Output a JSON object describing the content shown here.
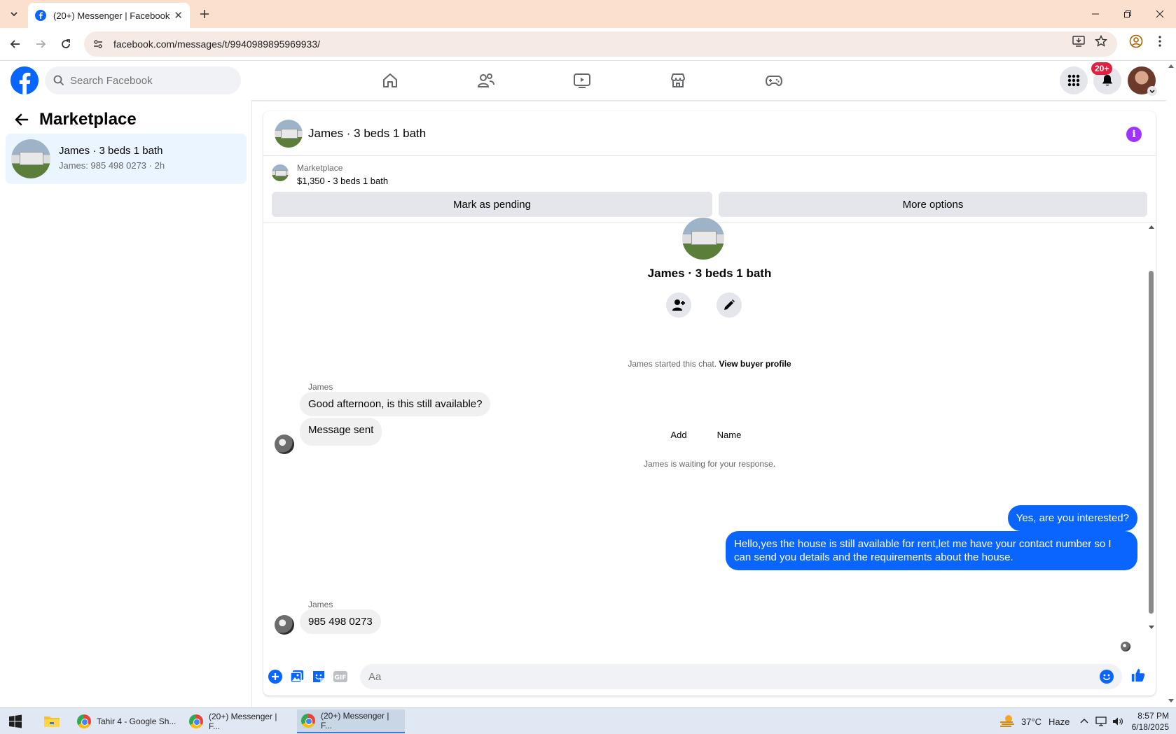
{
  "browser": {
    "tab_title": "(20+) Messenger | Facebook",
    "url": "facebook.com/messages/t/9940989895969933/"
  },
  "fb": {
    "search_placeholder": "Search Facebook",
    "notifications_badge": "20+",
    "brand_color": "#0866ff"
  },
  "sidebar": {
    "title": "Marketplace",
    "conversations": [
      {
        "name": "James · 3 beds 1 bath",
        "preview": "James: 985 498 0273 · 2h"
      }
    ]
  },
  "chat": {
    "header_name": "James · 3 beds 1 bath",
    "listing": {
      "label": "Marketplace",
      "price_title": "$1,350 - 3 beds 1 bath",
      "mark_pending": "Mark as pending",
      "more_options": "More options"
    },
    "profile_name": "James · 3 beds 1 bath",
    "actions": {
      "add": "Add",
      "name": "Name"
    },
    "started_text": "James started this chat.",
    "view_profile": "View buyer profile",
    "waiting_text": "James is waiting for your response.",
    "messages": [
      {
        "sender": "James",
        "text": "Good afternoon, is this still available?"
      },
      {
        "text": "Message sent"
      },
      {
        "text": "Yes, are you interested?"
      },
      {
        "text": "Hello,yes the house is still available for rent,let me have your contact number   so I can send you details and the requirements about the house."
      },
      {
        "sender": "James",
        "text": "985 498 0273"
      }
    ],
    "composer_placeholder": "Aa",
    "outgoing_color": "#0a65ff"
  },
  "taskbar": {
    "items": [
      "Tahir 4 - Google Sh...",
      "(20+) Messenger | F...",
      "(20+) Messenger | F..."
    ],
    "weather": "37°C",
    "weather_desc": "Haze",
    "time": "8:57 PM",
    "date": "6/18/2025"
  }
}
